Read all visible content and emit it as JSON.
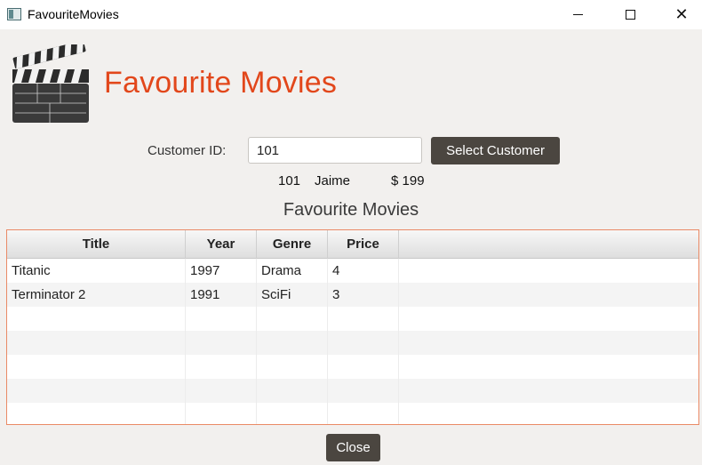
{
  "window": {
    "title": "FavouriteMovies",
    "controls": {
      "minimize": "minimize-icon",
      "maximize": "maximize-icon",
      "close": "close-icon"
    }
  },
  "header": {
    "title": "Favourite Movies",
    "logo_icon": "clapperboard-icon",
    "title_color": "#e2471b"
  },
  "customer": {
    "label": "Customer ID:",
    "input_value": "101",
    "button_label": "Select Customer"
  },
  "info": {
    "id": "101",
    "name": "Jaime",
    "balance": "$ 199"
  },
  "section_title": "Favourite Movies",
  "table": {
    "headers": [
      "Title",
      "Year",
      "Genre",
      "Price"
    ],
    "rows": [
      [
        "Titanic",
        "1997",
        "Drama",
        "4"
      ],
      [
        "Terminator 2",
        "1991",
        "SciFi",
        "3"
      ]
    ]
  },
  "close_label": "Close",
  "colors": {
    "button_bg": "#4b4640",
    "table_border": "#ea8a66"
  }
}
